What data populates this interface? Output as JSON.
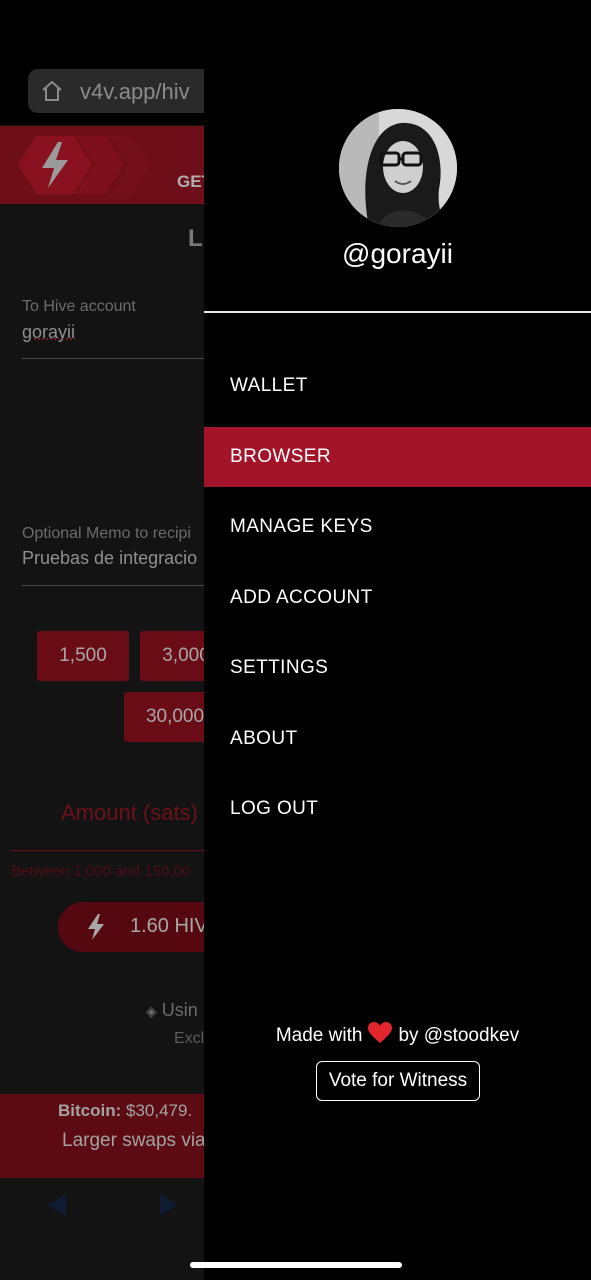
{
  "browser": {
    "url": "v4v.app/hiv"
  },
  "page": {
    "banner_text": "GET",
    "heading_initial": "L",
    "to_account": {
      "label": "To Hive account",
      "value": "gorayii"
    },
    "memo": {
      "label": "Optional Memo to recipi",
      "value": "Pruebas de integracio"
    },
    "amount_chips": [
      "1,500",
      "3,000",
      "30,000"
    ],
    "amount_label": "Amount (sats)",
    "amount_hint": "Between 1,000 and 150,00",
    "hive_button": "1.60 HIV",
    "using_text": "Usin",
    "excl_text": "Excl",
    "bitcoin_label": "Bitcoin:",
    "bitcoin_value": "$30,479.",
    "larger_swaps": "Larger swaps via"
  },
  "drawer": {
    "username": "@gorayii",
    "menu": [
      {
        "label": "WALLET",
        "active": false
      },
      {
        "label": "BROWSER",
        "active": true
      },
      {
        "label": "MANAGE KEYS",
        "active": false
      },
      {
        "label": "ADD ACCOUNT",
        "active": false
      },
      {
        "label": "SETTINGS",
        "active": false
      },
      {
        "label": "ABOUT",
        "active": false
      },
      {
        "label": "LOG OUT",
        "active": false
      }
    ],
    "made_with_prefix": "Made with",
    "made_with_suffix": "by @stoodkev",
    "vote_button": "Vote for Witness"
  },
  "colors": {
    "accent": "#a3132a",
    "drawer_bg": "#000000"
  }
}
